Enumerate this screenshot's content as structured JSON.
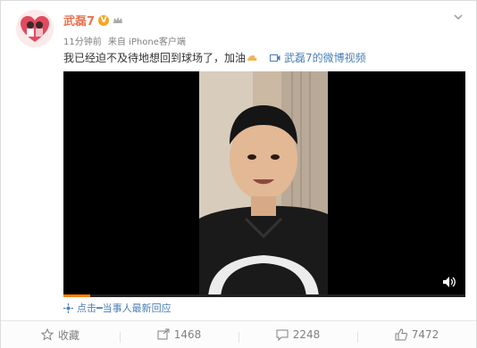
{
  "user": {
    "name": "武磊7",
    "verified_badge": "V"
  },
  "meta": {
    "time": "11分钟前",
    "source": "来自 iPhone客户端"
  },
  "post": {
    "text": "我已经迫不及待地想回到球场了，加油",
    "video_link": "武磊7的微博视频"
  },
  "video": {
    "progress": 0.067
  },
  "reply_prompt": "点击━当事人最新回应",
  "footer": {
    "favorite_label": "收藏",
    "repost_count": "1468",
    "comment_count": "2248",
    "like_count": "7472"
  },
  "colors": {
    "name": "#eb7350",
    "link": "#4a7fb4",
    "progress": "#ff8200",
    "badge": "#f5a623"
  }
}
